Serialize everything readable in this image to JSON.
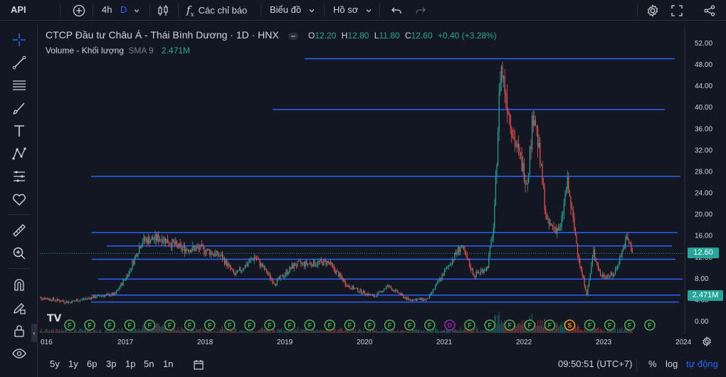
{
  "topbar": {
    "app_title": "API",
    "interval_label": "4h",
    "interval_active": "D",
    "indicators_label": "Các chỉ báo",
    "chart_label": "Biểu đồ",
    "profile_label": "Hồ sơ"
  },
  "legend": {
    "symbol": "CTCP Đầu tư Châu Á - Thái Bình Dương · 1D · HNX",
    "o_key": "O",
    "o_val": "12.20",
    "h_key": "H",
    "h_val": "12.80",
    "l_key": "L",
    "l_val": "11.80",
    "c_key": "C",
    "c_val": "12.60",
    "change": "+0.40 (+3.28%)",
    "volume_name": "Volume - Khối lượng",
    "volume_sma": "SMA 9",
    "volume_value": "2.471M"
  },
  "price_axis": {
    "ticks": [
      "52.00",
      "48.00",
      "44.00",
      "40.00",
      "36.00",
      "32.00",
      "28.00",
      "24.00",
      "20.00",
      "16.00",
      "12.00",
      "8.00",
      "4.00",
      "0.00"
    ],
    "last_price_badge": "12.60",
    "volume_badge": "2.471M"
  },
  "time_axis": {
    "ticks": [
      "016",
      "2017",
      "2018",
      "2019",
      "2020",
      "2021",
      "2022",
      "2023",
      "2024"
    ]
  },
  "event_markers": [
    "F",
    "F",
    "F",
    "F",
    "F",
    "F",
    "F",
    "F",
    "F",
    "F",
    "F",
    "F",
    "F",
    "F",
    "F",
    "F",
    "F",
    "F",
    "F",
    "D",
    "F",
    "F",
    "F",
    "F",
    "F",
    "S",
    "F",
    "F",
    "F",
    "F"
  ],
  "bottombar": {
    "ranges": [
      "5y",
      "1y",
      "6p",
      "3p",
      "1p",
      "5n",
      "1n"
    ],
    "clock": "09:50:51 (UTC+7)",
    "percent": "%",
    "log": "log",
    "auto": "tự động"
  },
  "colors": {
    "up": "#26a69a",
    "down": "#ef5350",
    "hline": "#2962ff",
    "accent": "#2962ff",
    "bg": "#131722",
    "text": "#d1d4dc"
  },
  "chart_data": {
    "type": "candlestick",
    "ylim": [
      0,
      52
    ],
    "x_range": [
      "2016",
      "2024"
    ],
    "horizontal_levels": [
      49.0,
      39.5,
      27.0,
      16.5,
      14.0,
      11.5,
      7.8,
      4.8,
      3.5
    ],
    "price_path": [
      [
        "2016-01",
        4.5
      ],
      [
        "2016-06",
        3.5
      ],
      [
        "2016-10",
        4.5
      ],
      [
        "2017-01",
        5.0
      ],
      [
        "2017-03",
        9.0
      ],
      [
        "2017-05",
        15.0
      ],
      [
        "2017-08",
        15.5
      ],
      [
        "2017-11",
        13.5
      ],
      [
        "2018-02",
        13.5
      ],
      [
        "2018-05",
        12.0
      ],
      [
        "2018-07",
        8.5
      ],
      [
        "2018-10",
        12.0
      ],
      [
        "2019-01",
        7.0
      ],
      [
        "2019-04",
        10.5
      ],
      [
        "2019-09",
        11.0
      ],
      [
        "2019-12",
        6.5
      ],
      [
        "2020-04",
        4.5
      ],
      [
        "2020-06",
        6.5
      ],
      [
        "2020-09",
        4.0
      ],
      [
        "2020-12",
        4.0
      ],
      [
        "2021-01",
        6.0
      ],
      [
        "2021-03",
        10.0
      ],
      [
        "2021-05",
        14.0
      ],
      [
        "2021-07",
        8.5
      ],
      [
        "2021-09",
        10.0
      ],
      [
        "2021-10",
        18.0
      ],
      [
        "2021-11",
        48.0
      ],
      [
        "2022-01",
        34.0
      ],
      [
        "2022-03",
        26.0
      ],
      [
        "2022-04",
        40.0
      ],
      [
        "2022-06",
        18.0
      ],
      [
        "2022-08",
        17.0
      ],
      [
        "2022-09",
        26.0
      ],
      [
        "2022-11",
        10.0
      ],
      [
        "2022-12",
        5.0
      ],
      [
        "2023-01",
        13.0
      ],
      [
        "2023-02",
        8.5
      ],
      [
        "2023-04",
        8.5
      ],
      [
        "2023-06",
        15.5
      ],
      [
        "2023-07",
        12.6
      ]
    ],
    "last": {
      "open": 12.2,
      "high": 12.8,
      "low": 11.8,
      "close": 12.6
    }
  }
}
